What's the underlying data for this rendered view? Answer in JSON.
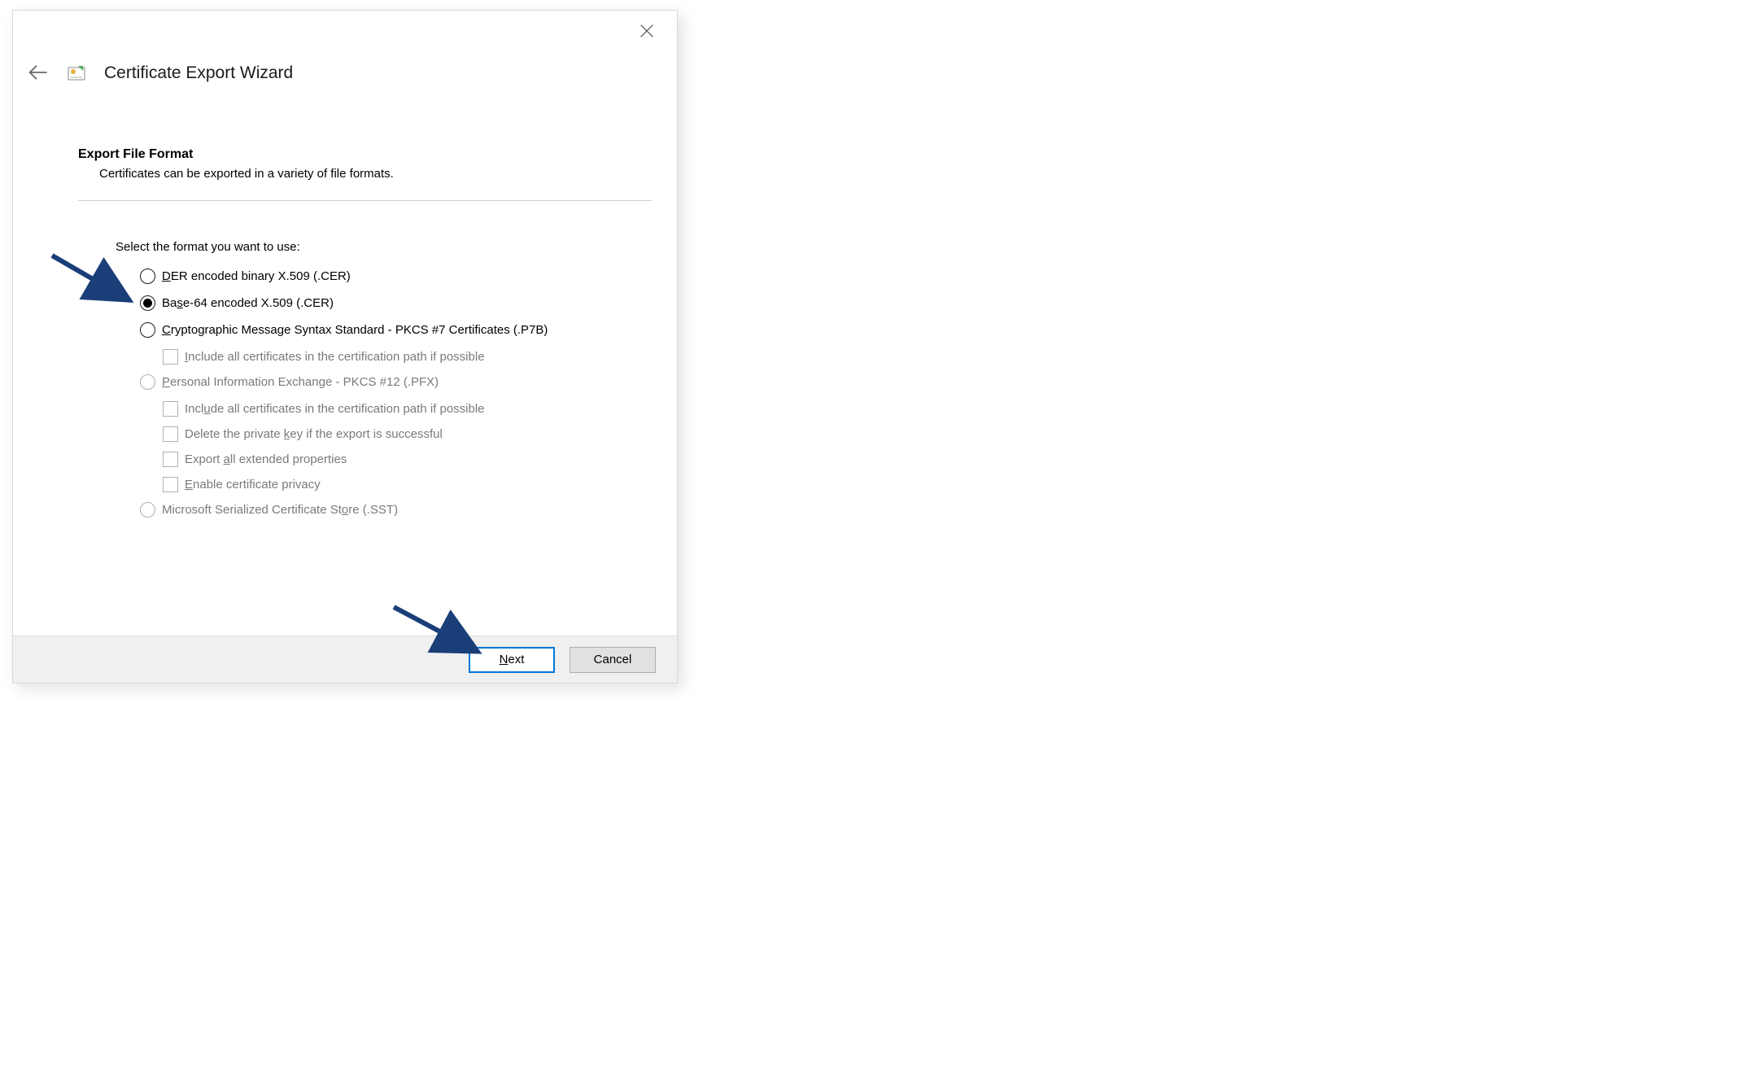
{
  "window": {
    "title": "Certificate Export Wizard"
  },
  "page": {
    "section_title": "Export File Format",
    "section_desc": "Certificates can be exported in a variety of file formats.",
    "select_label": "Select the format you want to use:"
  },
  "options": {
    "der": {
      "pre": "",
      "u": "D",
      "post": "ER encoded binary X.509 (.CER)",
      "selected": false,
      "enabled": true
    },
    "base64": {
      "pre": "Ba",
      "u": "s",
      "post": "e-64 encoded X.509 (.CER)",
      "selected": true,
      "enabled": true
    },
    "pkcs7": {
      "pre": "",
      "u": "C",
      "post": "ryptographic Message Syntax Standard - PKCS #7 Certificates (.P7B)",
      "selected": false,
      "enabled": true
    },
    "pkcs7_sub_include": {
      "pre": "",
      "u": "I",
      "post": "nclude all certificates in the certification path if possible",
      "checked": false,
      "enabled": false
    },
    "pfx": {
      "pre": "",
      "u": "P",
      "post": "ersonal Information Exchange - PKCS #12 (.PFX)",
      "selected": false,
      "enabled": false
    },
    "pfx_sub_include": {
      "pre": "Incl",
      "u": "u",
      "post": "de all certificates in the certification path if possible",
      "checked": false,
      "enabled": false
    },
    "pfx_sub_delete": {
      "pre": "Delete the private ",
      "u": "k",
      "post": "ey if the export is successful",
      "checked": false,
      "enabled": false
    },
    "pfx_sub_extended": {
      "pre": "Export ",
      "u": "a",
      "post": "ll extended properties",
      "checked": false,
      "enabled": false
    },
    "pfx_sub_privacy": {
      "pre": "",
      "u": "E",
      "post": "nable certificate privacy",
      "checked": false,
      "enabled": false
    },
    "sst": {
      "pre": "Microsoft Serialized Certificate St",
      "u": "o",
      "post": "re (.SST)",
      "selected": false,
      "enabled": false
    }
  },
  "footer": {
    "next_pre": "",
    "next_u": "N",
    "next_post": "ext",
    "cancel": "Cancel"
  }
}
